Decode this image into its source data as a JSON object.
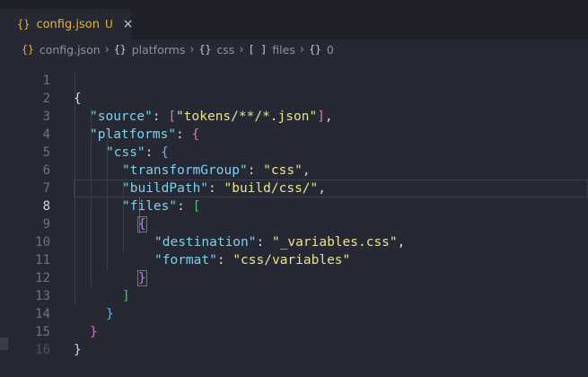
{
  "tab": {
    "icon": "{}",
    "filename": "config.json",
    "modified_badge": "U",
    "close": "×"
  },
  "breadcrumb": [
    {
      "icon": "{}",
      "label": "config.json"
    },
    {
      "icon": "{}",
      "label": "platforms"
    },
    {
      "icon": "{}",
      "label": "css"
    },
    {
      "icon": "[ ]",
      "label": "files"
    },
    {
      "icon": "{}",
      "label": "0"
    }
  ],
  "breadcrumb_separator": "›",
  "editor": {
    "active_line": 8,
    "line_numbers": [
      "1",
      "2",
      "3",
      "4",
      "5",
      "6",
      "7",
      "8",
      "9",
      "10",
      "11",
      "12",
      "13",
      "14",
      "15",
      "16"
    ],
    "lines": {
      "l1_open": "{",
      "l2_key": "\"source\"",
      "l2_colon": ": ",
      "l2_open": "[",
      "l2_val": "\"tokens/**/*.json\"",
      "l2_close": "]",
      "l2_comma": ",",
      "l3_key": "\"platforms\"",
      "l3_colon": ": ",
      "l3_open": "{",
      "l4_key": "\"css\"",
      "l4_colon": ": ",
      "l4_open": "{",
      "l5_key": "\"transformGroup\"",
      "l5_colon": ": ",
      "l5_val": "\"css\"",
      "l5_comma": ",",
      "l6_key": "\"buildPath\"",
      "l6_colon": ": ",
      "l6_val": "\"build/css/\"",
      "l6_comma": ",",
      "l7_key": "\"files\"",
      "l7_colon": ": ",
      "l7_open": "[",
      "l8_open": "{",
      "l9_key": "\"destination\"",
      "l9_colon": ": ",
      "l9_val": "\"_variables.css\"",
      "l9_comma": ",",
      "l10_key": "\"format\"",
      "l10_colon": ": ",
      "l10_val": "\"css/variables\"",
      "l11_close": "}",
      "l12_close": "]",
      "l13_close": "}",
      "l14_close": "}",
      "l15_close": "}"
    }
  },
  "colors": {
    "background": "#262833",
    "key": "#7ed0f0",
    "string": "#e8e48f",
    "bracket_level1": "#e3b341",
    "bracket_level2": "#e36bc7",
    "bracket_level3": "#56b6f0",
    "bracket_level4": "#4ec06c",
    "bracket_level5": "#b686e8"
  }
}
